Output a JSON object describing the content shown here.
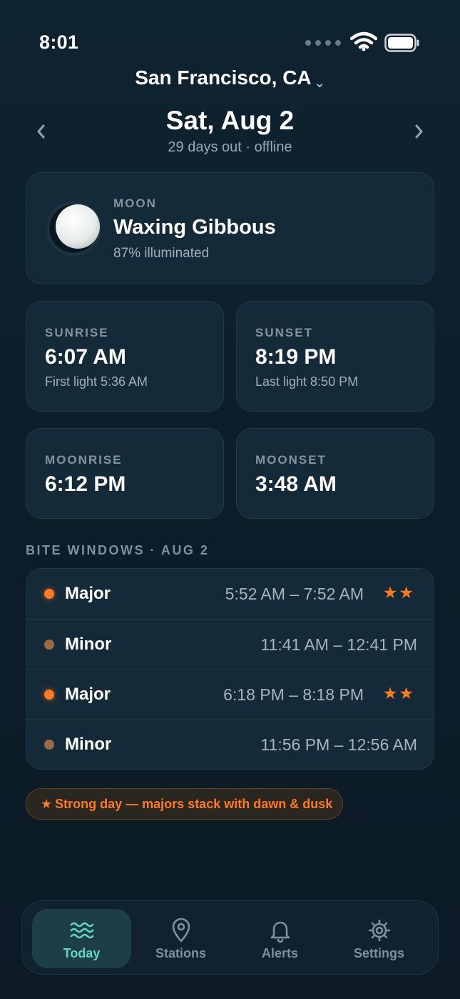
{
  "status_bar": {
    "time": "8:01"
  },
  "header": {
    "location": "San Francisco, CA",
    "location_chevron": "chevron-down-icon"
  },
  "date_nav": {
    "date": "Sat, Aug 2",
    "subtitle": "29 days out · offline",
    "prev_icon": "chevron-left-icon",
    "next_icon": "chevron-right-icon"
  },
  "moon": {
    "label": "MOON",
    "phase": "Waxing Gibbous",
    "illumination_text": "87% illuminated",
    "illumination": 0.87
  },
  "tiles": [
    {
      "label": "SUNRISE",
      "value": "6:07 AM",
      "sub": "First light 5:36 AM"
    },
    {
      "label": "SUNSET",
      "value": "8:19 PM",
      "sub": "Last light 8:50 PM"
    },
    {
      "label": "MOONRISE",
      "value": "6:12 PM",
      "sub": ""
    },
    {
      "label": "MOONSET",
      "value": "3:48 AM",
      "sub": ""
    }
  ],
  "bite_windows": {
    "title": "BITE WINDOWS · AUG 2",
    "rows": [
      {
        "kind": "Major",
        "time": "5:52 AM – 7:52 AM",
        "stars": "★★"
      },
      {
        "kind": "Minor",
        "time": "11:41 AM – 12:41 PM",
        "stars": ""
      },
      {
        "kind": "Major",
        "time": "6:18 PM – 8:18 PM",
        "stars": "★★"
      },
      {
        "kind": "Minor",
        "time": "11:56 PM – 12:56 AM",
        "stars": ""
      }
    ]
  },
  "note": {
    "star": "★",
    "text": "Strong day — majors stack with dawn & dusk"
  },
  "tabbar": {
    "tabs": [
      {
        "label": "Today",
        "icon": "waves-icon",
        "active": true
      },
      {
        "label": "Stations",
        "icon": "map-pin-icon",
        "active": false
      },
      {
        "label": "Alerts",
        "icon": "bell-icon",
        "active": false
      },
      {
        "label": "Settings",
        "icon": "gear-icon",
        "active": false
      }
    ]
  },
  "colors": {
    "background": "#0c1d29",
    "card": "#152a38",
    "accent_orange": "#ff7a21",
    "accent_teal": "#5ed8c2",
    "minor_dot": "#9a6a47"
  }
}
